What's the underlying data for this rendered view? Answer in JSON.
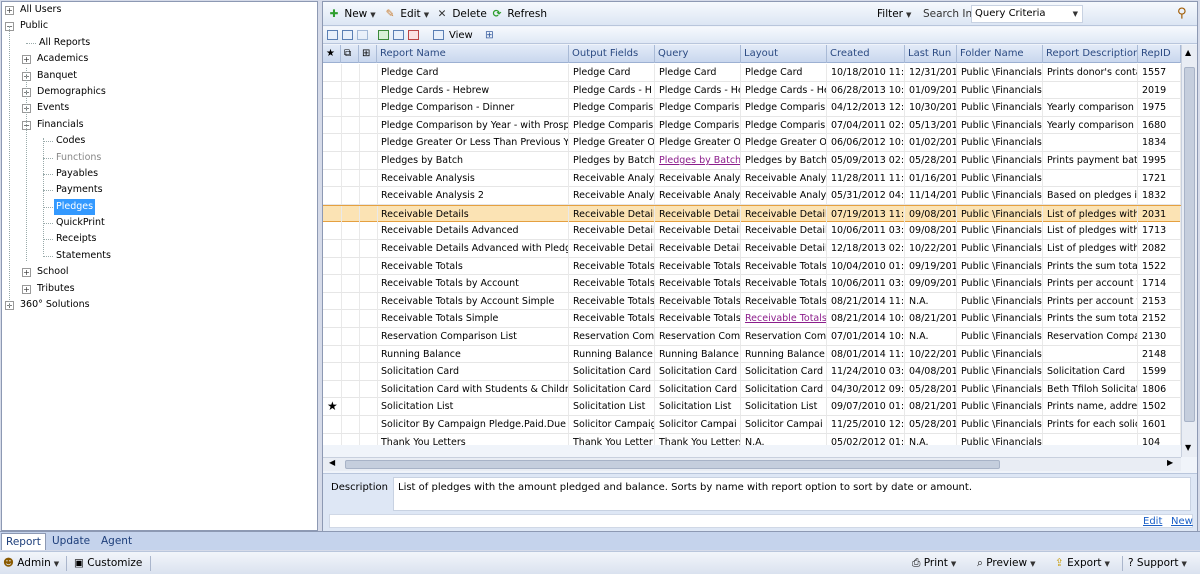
{
  "tree": [
    {
      "label": "All Users",
      "level": 0,
      "expander": "+"
    },
    {
      "label": "Public",
      "level": 0,
      "expander": "-"
    },
    {
      "label": "All Reports",
      "level": 1,
      "expander": ""
    },
    {
      "label": "Academics",
      "level": 1,
      "expander": "+"
    },
    {
      "label": "Banquet",
      "level": 1,
      "expander": "+"
    },
    {
      "label": "Demographics",
      "level": 1,
      "expander": "+"
    },
    {
      "label": "Events",
      "level": 1,
      "expander": "+"
    },
    {
      "label": "Financials",
      "level": 1,
      "expander": "-"
    },
    {
      "label": "Codes",
      "level": 2,
      "expander": ""
    },
    {
      "label": "Functions",
      "level": 2,
      "expander": "",
      "dim": true
    },
    {
      "label": "Payables",
      "level": 2,
      "expander": ""
    },
    {
      "label": "Payments",
      "level": 2,
      "expander": ""
    },
    {
      "label": "Pledges",
      "level": 2,
      "expander": "",
      "selected": true
    },
    {
      "label": "QuickPrint",
      "level": 2,
      "expander": ""
    },
    {
      "label": "Receipts",
      "level": 2,
      "expander": ""
    },
    {
      "label": "Statements",
      "level": 2,
      "expander": ""
    },
    {
      "label": "School",
      "level": 1,
      "expander": "+"
    },
    {
      "label": "Tributes",
      "level": 1,
      "expander": "+"
    },
    {
      "label": "360° Solutions",
      "level": 0,
      "expander": "+"
    }
  ],
  "toolbar": {
    "new_label": "New",
    "edit_label": "Edit",
    "delete_label": "Delete",
    "refresh_label": "Refresh",
    "filter_label": "Filter",
    "search_in_label": "Search In",
    "search_in_value": "Query Criteria"
  },
  "toolbar2": {
    "view_label": "View"
  },
  "columns": [
    "Report Name",
    "Output Fields",
    "Query",
    "Layout",
    "Created",
    "Last Run",
    "Folder Name",
    "Report Description",
    "RepID"
  ],
  "rows": [
    {
      "name": "Pledge Card",
      "output": "Pledge Card",
      "query": "Pledge Card",
      "layout": "Pledge Card",
      "created": "10/18/2010 11:4",
      "lastrun": "12/31/201",
      "folder": "Public \\Financials",
      "desc": "Prints donor's conta",
      "id": "1557"
    },
    {
      "name": "Pledge Cards - Hebrew",
      "output": "Pledge Cards - H",
      "query": "Pledge Cards - He",
      "layout": "Pledge Cards - He",
      "created": "06/28/2013 10:0",
      "lastrun": "01/09/201",
      "folder": "Public \\Financials",
      "desc": "",
      "id": "2019"
    },
    {
      "name": "Pledge Comparison - Dinner",
      "output": "Pledge Comparis",
      "query": "Pledge Comparis",
      "layout": "Pledge Comparis",
      "created": "04/12/2013 12:3",
      "lastrun": "10/30/201",
      "folder": "Public \\Financials",
      "desc": "Yearly comparison",
      "id": "1975"
    },
    {
      "name": "Pledge Comparison by Year - with Prospe",
      "output": "Pledge Comparis",
      "query": "Pledge Comparis",
      "layout": "Pledge Comparis",
      "created": "07/04/2011 02:2",
      "lastrun": "05/13/201",
      "folder": "Public \\Financials",
      "desc": "Yearly comparison",
      "id": "1680"
    },
    {
      "name": "Pledge Greater Or Less Than Previous Yea",
      "output": "Pledge Greater O",
      "query": "Pledge Greater Or",
      "layout": "Pledge Greater Or",
      "created": "06/06/2012 10:1",
      "lastrun": "01/02/201",
      "folder": "Public \\Financials",
      "desc": "",
      "id": "1834"
    },
    {
      "name": "Pledges by Batch",
      "output": "Pledges by Batch",
      "query": "Pledges by Batch -",
      "layout": "Pledges by Batch",
      "created": "05/09/2013 02:3",
      "lastrun": "05/28/201",
      "folder": "Public \\Financials",
      "desc": "Prints payment batc",
      "id": "1995",
      "querylink": true
    },
    {
      "name": "Receivable Analysis",
      "output": "Receivable Analy",
      "query": "Receivable Analysi",
      "layout": "Receivable Analysi",
      "created": "11/28/2011 11:0",
      "lastrun": "01/16/201",
      "folder": "Public \\Financials",
      "desc": "",
      "id": "1721"
    },
    {
      "name": "Receivable Analysis 2",
      "output": "Receivable Analy",
      "query": "Receivable Analysi",
      "layout": "Receivable Analysi",
      "created": "05/31/2012 04:3",
      "lastrun": "11/14/201",
      "folder": "Public \\Financials",
      "desc": "Based on pledges in",
      "id": "1832"
    },
    {
      "name": "Receivable Details",
      "output": "Receivable Detail",
      "query": "Receivable Details",
      "layout": "Receivable Details",
      "created": "07/19/2013 11:2",
      "lastrun": "09/08/201",
      "folder": "Public \\Financials",
      "desc": "List of pledges with",
      "id": "2031",
      "selected": true
    },
    {
      "name": "Receivable Details Advanced",
      "output": "Receivable Detail",
      "query": "Receivable Detail",
      "layout": "Receivable Detail",
      "created": "10/06/2011 03:3",
      "lastrun": "09/08/201",
      "folder": "Public \\Financials",
      "desc": "List of pledges with",
      "id": "1713"
    },
    {
      "name": "Receivable Details Advanced with Pledge",
      "output": "Receivable Detail",
      "query": "Receivable Detail",
      "layout": "Receivable Detail",
      "created": "12/18/2013 02:5",
      "lastrun": "10/22/201",
      "folder": "Public \\Financials",
      "desc": "List of pledges with",
      "id": "2082"
    },
    {
      "name": "Receivable Totals",
      "output": "Receivable Totals",
      "query": "Receivable Totals",
      "layout": "Receivable Totals",
      "created": "10/04/2010 01:1",
      "lastrun": "09/19/201",
      "folder": "Public \\Financials",
      "desc": "Prints the sum total",
      "id": "1522"
    },
    {
      "name": "Receivable Totals by Account",
      "output": "Receivable Totals",
      "query": "Receivable Totals",
      "layout": "Receivable Totals",
      "created": "10/06/2011 03:3",
      "lastrun": "09/09/201",
      "folder": "Public \\Financials",
      "desc": "Prints per account t",
      "id": "1714"
    },
    {
      "name": "Receivable Totals by Account Simple",
      "output": "Receivable Totals",
      "query": "Receivable Totals",
      "layout": "Receivable Totals",
      "created": "08/21/2014 11:3",
      "lastrun": "N.A.",
      "folder": "Public \\Financials",
      "desc": "Prints per account t",
      "id": "2153"
    },
    {
      "name": "Receivable Totals Simple",
      "output": "Receivable Totals",
      "query": "Receivable Totals",
      "layout": "Receivable Totals",
      "created": "08/21/2014 10:4",
      "lastrun": "08/21/201",
      "folder": "Public \\Financials",
      "desc": "Prints the sum total",
      "id": "2152",
      "layoutlink": true
    },
    {
      "name": "Reservation Comparison List",
      "output": "Reservation Com",
      "query": "Reservation Com",
      "layout": "Reservation Com",
      "created": "07/01/2014 10:4",
      "lastrun": "N.A.",
      "folder": "Public \\Financials",
      "desc": "Reservation Compar",
      "id": "2130"
    },
    {
      "name": "Running Balance",
      "output": "Running Balance",
      "query": "Running Balance",
      "layout": "Running Balance",
      "created": "08/01/2014 11:0",
      "lastrun": "10/22/201",
      "folder": "Public \\Financials",
      "desc": "",
      "id": "2148"
    },
    {
      "name": "Solicitation Card",
      "output": "Solicitation Card",
      "query": "Solicitation Card -",
      "layout": "Solicitation Card",
      "created": "11/24/2010 03:1",
      "lastrun": "04/08/201",
      "folder": "Public \\Financials",
      "desc": "Solicitation Card",
      "id": "1599"
    },
    {
      "name": "Solicitation Card with Students & Childre",
      "output": "Solicitation Card",
      "query": "Solicitation Card",
      "layout": "Solicitation Card",
      "created": "04/30/2012 09:5",
      "lastrun": "05/28/201",
      "folder": "Public \\Financials",
      "desc": "Beth Tfiloh Solicitati",
      "id": "1806"
    },
    {
      "name": "Solicitation List",
      "output": "Solicitation List",
      "query": "Solicitation List",
      "layout": "Solicitation List",
      "created": "09/07/2010 01:0",
      "lastrun": "08/21/201",
      "folder": "Public \\Financials",
      "desc": "Prints name, addres",
      "id": "1502",
      "star": true
    },
    {
      "name": "Solicitor By Campaign Pledge.Paid.Due T",
      "output": "Solicitor Campaig",
      "query": "Solicitor Campai",
      "layout": "Solicitor Campai",
      "created": "11/25/2010 12:3",
      "lastrun": "05/28/201",
      "folder": "Public \\Financials",
      "desc": "Prints for each solici",
      "id": "1601"
    },
    {
      "name": "Thank You Letters",
      "output": "Thank You Letter",
      "query": "Thank You Letters",
      "layout": "N.A.",
      "created": "05/02/2012 01:0",
      "lastrun": "N.A.",
      "folder": "Public \\Financials",
      "desc": "",
      "id": "104"
    }
  ],
  "description": {
    "label": "Description",
    "text": "List of pledges with the amount pledged and balance. Sorts by name with report option to sort by date or amount.",
    "edit_label": "Edit",
    "new_label": "New"
  },
  "tabs": [
    "Report",
    "Update",
    "Agent"
  ],
  "status": {
    "admin_label": "Admin",
    "customize_label": "Customize",
    "print_label": "Print",
    "preview_label": "Preview",
    "export_label": "Export",
    "support_label": "Support"
  },
  "colors": {
    "accent": "#3399ff",
    "selected_row": "#fbe3b4",
    "link": "#8b1d8b"
  }
}
